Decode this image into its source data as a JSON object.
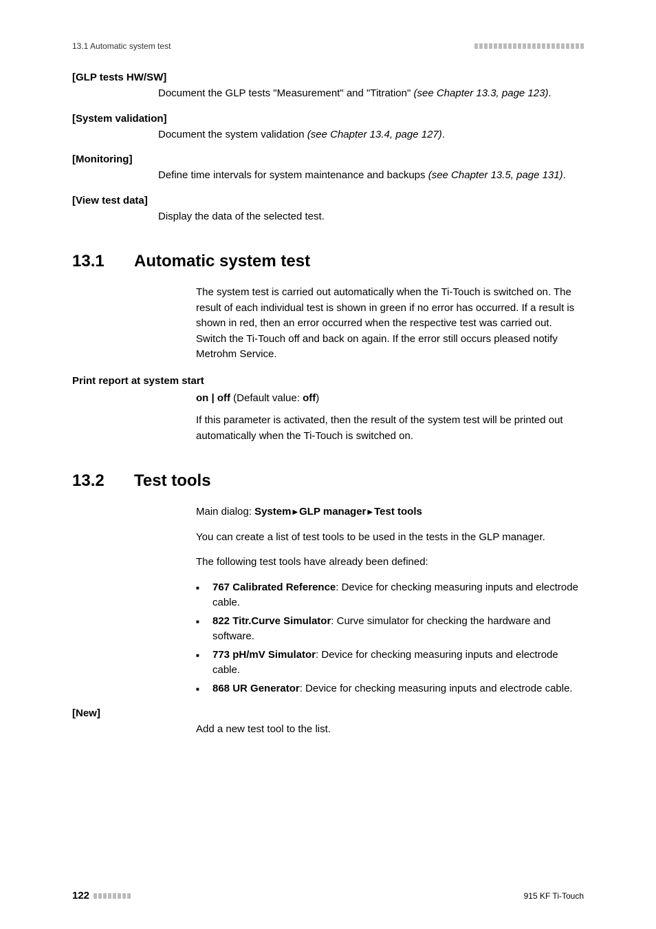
{
  "header": {
    "left": "13.1 Automatic system test"
  },
  "defs": {
    "glp_tests": {
      "term": "[GLP tests HW/SW]",
      "desc_pre": "Document the GLP tests \"Measurement\" and \"Titration\" ",
      "desc_italic": "(see Chapter 13.3, page 123)",
      "desc_post": "."
    },
    "system_validation": {
      "term": "[System validation]",
      "desc_pre": "Document the system validation ",
      "desc_italic": "(see Chapter 13.4, page 127)",
      "desc_post": "."
    },
    "monitoring": {
      "term": "[Monitoring]",
      "desc_pre": "Define time intervals for system maintenance and backups ",
      "desc_italic": "(see Chapter 13.5, page 131)",
      "desc_post": "."
    },
    "view_test_data": {
      "term": "[View test data]",
      "desc": "Display the data of the selected test."
    },
    "new": {
      "term": "[New]",
      "desc": "Add a new test tool to the list."
    }
  },
  "sec131": {
    "num": "13.1",
    "title": "Automatic system test",
    "p1": "The system test is carried out automatically when the Ti-Touch is switched on. The result of each individual test is shown in green if no error has occurred. If a result is shown in red, then an error occurred when the respective test was carried out. Switch the Ti-Touch off and back on again. If the error still occurs pleased notify Metrohm Service.",
    "param": {
      "name": "Print report at system start",
      "val_bold1": "on | off",
      "val_mid": " (Default value: ",
      "val_bold2": "off",
      "val_post": ")",
      "desc": "If this parameter is activated, then the result of the system test will be printed out automatically when the Ti-Touch is switched on."
    }
  },
  "sec132": {
    "num": "13.2",
    "title": "Test tools",
    "main_dialog_pre": "Main dialog: ",
    "main_dialog_b1": "System",
    "main_dialog_b2": "GLP manager",
    "main_dialog_b3": "Test tools",
    "p1": "You can create a list of test tools to be used in the tests in the GLP manager.",
    "p2": "The following test tools have already been defined:",
    "bullets": [
      {
        "bold": "767 Calibrated Reference",
        "rest": ": Device for checking measuring inputs and electrode cable."
      },
      {
        "bold": "822 Titr.Curve Simulator",
        "rest": ": Curve simulator for checking the hardware and software."
      },
      {
        "bold": "773 pH/mV Simulator",
        "rest": ": Device for checking measuring inputs and electrode cable."
      },
      {
        "bold": "868 UR Generator",
        "rest": ": Device for checking measuring inputs and electrode cable."
      }
    ]
  },
  "footer": {
    "page": "122",
    "right": "915 KF Ti-Touch"
  }
}
